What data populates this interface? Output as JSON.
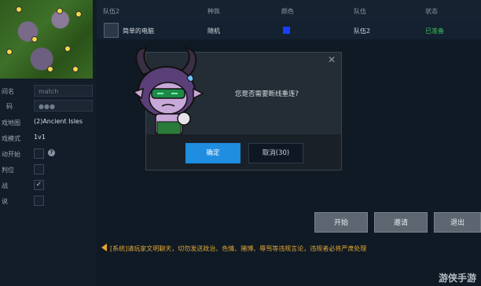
{
  "left_panel": {
    "rows": [
      {
        "label": "间名",
        "placeholder": "match"
      },
      {
        "label": "码",
        "placeholder": "●●●"
      },
      {
        "label": "戏地图",
        "value": "(2)Ancient Isles"
      },
      {
        "label": "戏模式",
        "value": "1v1"
      },
      {
        "label": "动开始",
        "checked": false
      },
      {
        "label": "判位",
        "checked": false
      },
      {
        "label": "战",
        "checked": true
      },
      {
        "label": "说",
        "checked": false
      }
    ],
    "check_mark": "✓",
    "help_glyph": "?"
  },
  "table": {
    "headers": [
      "队伍2",
      "种族",
      "颜色",
      "队伍",
      "状态"
    ],
    "rows": [
      {
        "name": "简单的电脑",
        "race": "随机",
        "color": "#1740ff",
        "team": "队伍2",
        "status": "已准备"
      }
    ]
  },
  "buttons": {
    "start": "开始",
    "invite": "邀请",
    "exit": "退出"
  },
  "notice": {
    "text": "[系统]请玩家文明聊天，切勿发送政治、色情、赌博、辱骂等违规言论，违规者必将严肃处理"
  },
  "watermark": "游侠手游",
  "dialog": {
    "close": "✕",
    "message": "您是否需要断线重连?",
    "confirm": "确定",
    "cancel": "取消(30)"
  },
  "colors": {
    "accent": "#1f8de0",
    "ready": "#3fbf5a",
    "notice": "#e2a534"
  }
}
